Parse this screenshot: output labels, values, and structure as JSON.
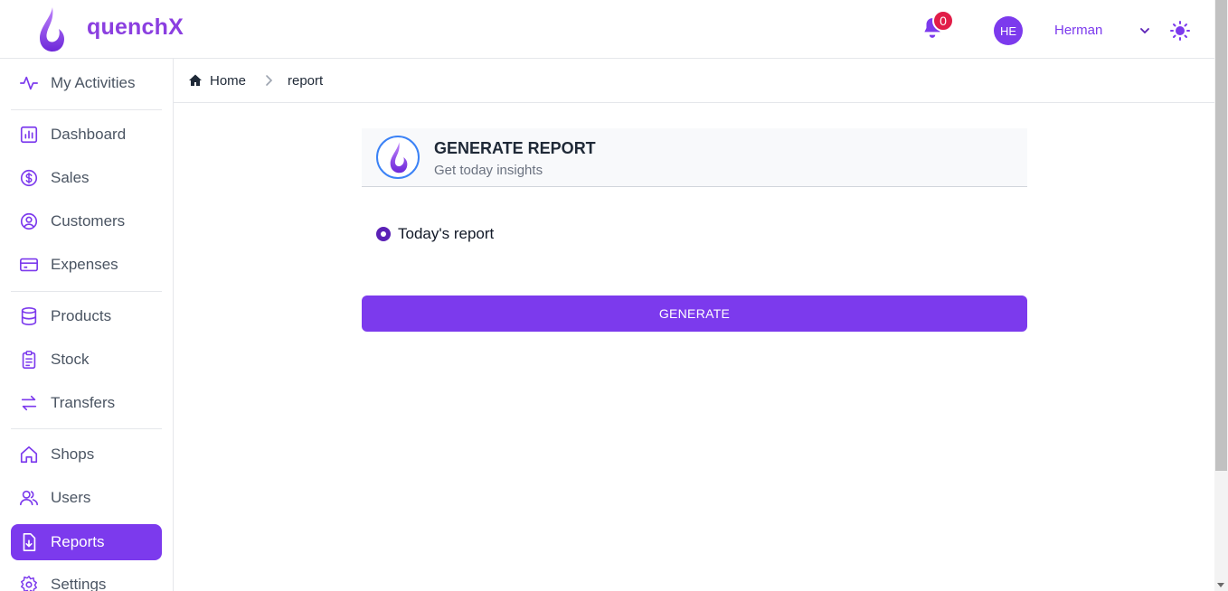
{
  "app": {
    "brand": "quenchX"
  },
  "header": {
    "notification_count": "0",
    "avatar_initials": "HE",
    "username": "Herman"
  },
  "sidebar": {
    "items": [
      {
        "label": "My Activities",
        "icon": "activity-icon"
      },
      {
        "label": "Dashboard",
        "icon": "bar-chart-icon"
      },
      {
        "label": "Sales",
        "icon": "dollar-icon"
      },
      {
        "label": "Customers",
        "icon": "user-circle-icon"
      },
      {
        "label": "Expenses",
        "icon": "credit-card-icon"
      },
      {
        "label": "Products",
        "icon": "database-icon"
      },
      {
        "label": "Stock",
        "icon": "clipboard-icon"
      },
      {
        "label": "Transfers",
        "icon": "arrows-swap-icon"
      },
      {
        "label": "Shops",
        "icon": "home-icon"
      },
      {
        "label": "Users",
        "icon": "users-icon"
      },
      {
        "label": "Reports",
        "icon": "document-download-icon",
        "active": true
      },
      {
        "label": "Settings",
        "icon": "gear-icon"
      }
    ]
  },
  "breadcrumb": {
    "home": "Home",
    "current": "report"
  },
  "card": {
    "title": "GENERATE REPORT",
    "subtitle": "Get today insights",
    "option_label": "Today's report",
    "button_label": "GENERATE"
  },
  "colors": {
    "accent": "#7c3aed",
    "brand": "#8b3fe0",
    "badge": "#e11d48"
  }
}
